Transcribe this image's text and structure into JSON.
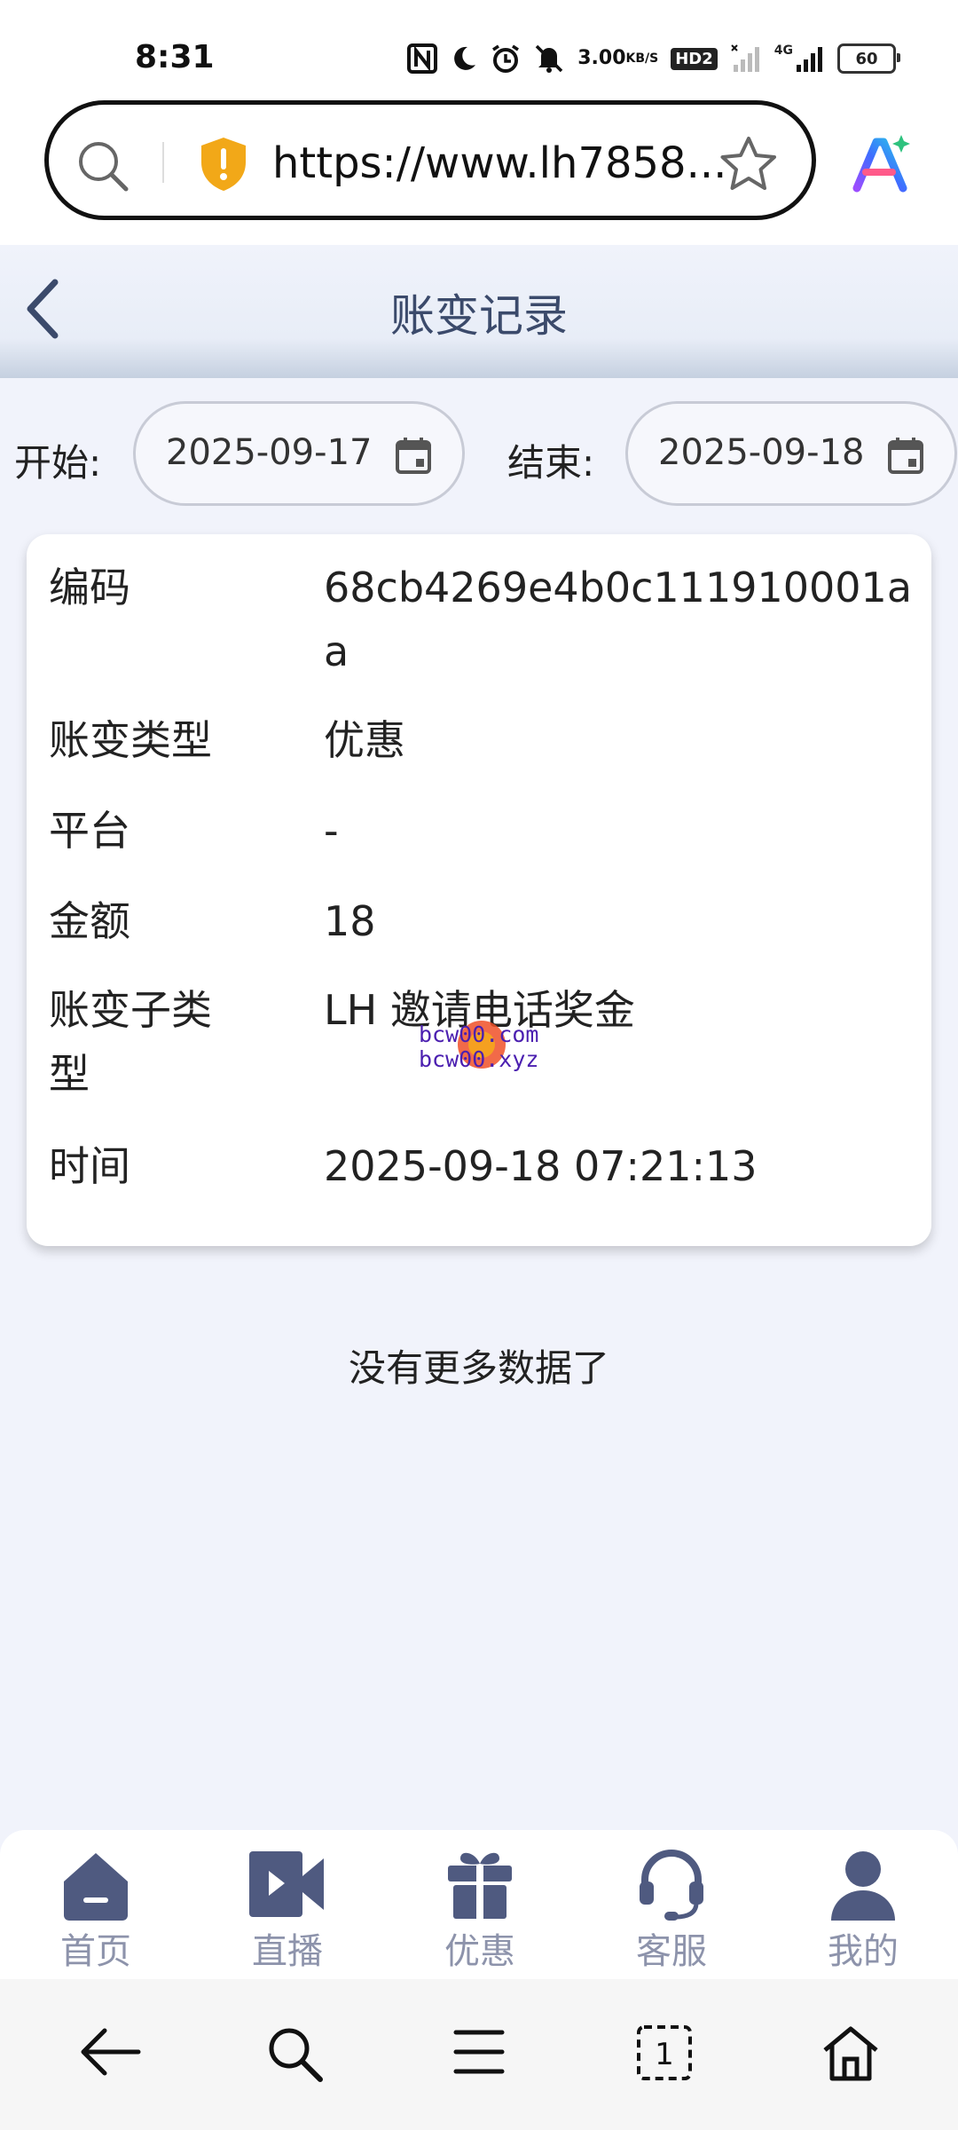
{
  "status_bar": {
    "time": "8:31",
    "net_speed_value": "3.00",
    "net_speed_unit": "KB/S",
    "hd_badge": "HD2",
    "network_type": "4G",
    "battery": "60",
    "icons": [
      "nfc-icon",
      "moon-icon",
      "alarm-icon",
      "mute-icon",
      "signal-icon"
    ]
  },
  "browser": {
    "url": "https://www.lh7858...",
    "icons": [
      "search-icon",
      "shield-warning-icon",
      "star-icon",
      "ai-assistant-icon"
    ]
  },
  "header": {
    "title": "账变记录",
    "back_icon": "chevron-left-icon"
  },
  "filter": {
    "start_label": "开始:",
    "start_value": "2025-09-17",
    "end_label": "结束:",
    "end_value": "2025-09-18",
    "calendar_icon": "calendar-icon"
  },
  "record": {
    "code_label": "编码",
    "code_value": "68cb4269e4b0c111910001aa",
    "type_label": "账变类型",
    "type_value": "优惠",
    "platform_label": "平台",
    "platform_value": "-",
    "amount_label": "金额",
    "amount_value": "18",
    "subtype_label": "账变子类型",
    "subtype_value": "LH 邀请电话奖金",
    "time_label": "时间",
    "time_value": "2025-09-18 07:21:13"
  },
  "watermark": {
    "line1": "bcw00.com",
    "line2": "bcw00.xyz"
  },
  "list_footer": "没有更多数据了",
  "bottom_nav": {
    "items": [
      {
        "label": "首页",
        "icon": "home-icon"
      },
      {
        "label": "直播",
        "icon": "live-video-icon"
      },
      {
        "label": "优惠",
        "icon": "gift-icon"
      },
      {
        "label": "客服",
        "icon": "headset-icon"
      },
      {
        "label": "我的",
        "icon": "user-icon"
      }
    ]
  },
  "system_nav": {
    "icons": [
      "back-arrow-icon",
      "search-icon",
      "menu-icon",
      "tabs-icon",
      "home-icon"
    ],
    "tab_count": "1"
  },
  "colors": {
    "page_bg": "#f1f3fb",
    "header_title": "#3b4a6b",
    "nav_icon": "#4f5a80",
    "nav_label": "#8d93ab",
    "shield": "#f2a818"
  }
}
